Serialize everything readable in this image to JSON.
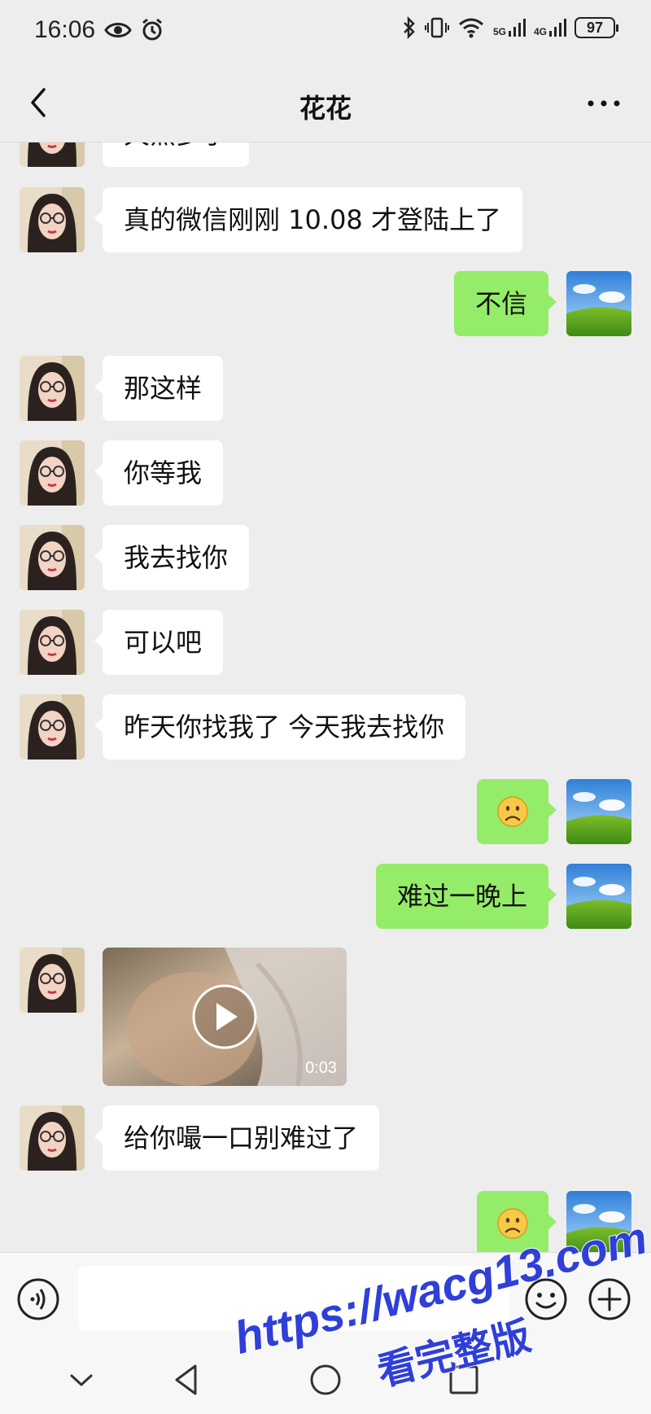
{
  "status_bar": {
    "time": "16:06",
    "net_5g": "5G",
    "net_4g": "4G",
    "battery": "97"
  },
  "header": {
    "title": "花花"
  },
  "messages": [
    {
      "side": "in",
      "type": "text",
      "text": "天黑多了"
    },
    {
      "side": "in",
      "type": "text",
      "text": "真的微信刚刚 10.08 才登陆上了"
    },
    {
      "side": "out",
      "type": "text",
      "text": "不信"
    },
    {
      "side": "in",
      "type": "text",
      "text": "那这样"
    },
    {
      "side": "in",
      "type": "text",
      "text": "你等我"
    },
    {
      "side": "in",
      "type": "text",
      "text": "我去找你"
    },
    {
      "side": "in",
      "type": "text",
      "text": "可以吧"
    },
    {
      "side": "in",
      "type": "text",
      "text": "昨天你找我了 今天我去找你"
    },
    {
      "side": "out",
      "type": "emoji",
      "emoji": "sad-face-icon"
    },
    {
      "side": "out",
      "type": "text",
      "text": "难过一晚上"
    },
    {
      "side": "in",
      "type": "video",
      "duration": "0:03"
    },
    {
      "side": "in",
      "type": "text",
      "text": "给你嘬一口别难过了"
    },
    {
      "side": "out",
      "type": "emoji",
      "emoji": "sad-face-icon"
    }
  ],
  "input": {
    "value": "",
    "placeholder": ""
  },
  "watermark": {
    "line1": "https://wacg13.com",
    "line2": "看完整版"
  },
  "colors": {
    "background": "#ededed",
    "incoming_bubble": "#ffffff",
    "outgoing_bubble": "#95ec69",
    "watermark": "#2f3fd8"
  }
}
